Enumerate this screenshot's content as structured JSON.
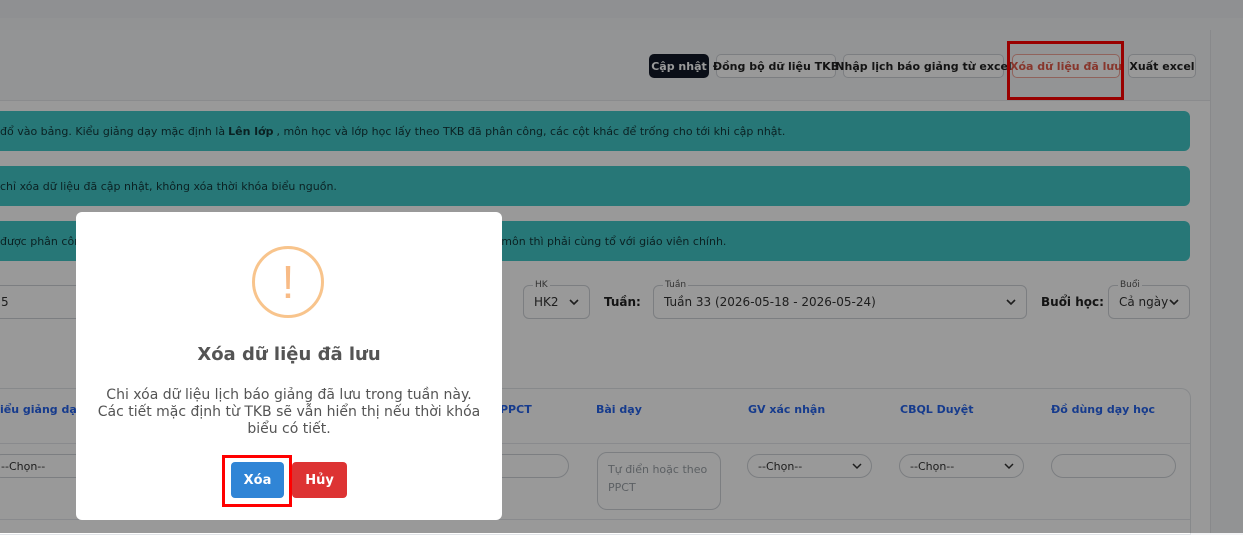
{
  "toolbar": {
    "update": "Cập nhật",
    "sync_tkb": "Đồng bộ dữ liệu TKB",
    "import_excel": "Nhập lịch báo giảng từ excel",
    "delete_saved": "Xóa dữ liệu đã lưu",
    "export_excel": "Xuất excel"
  },
  "alerts": {
    "a1_pre": "đổ vào bảng. Kiểu giảng dạy mặc định là",
    "a1_bold": "Lên lớp",
    "a1_post": ", môn học và lớp học lấy theo TKB đã phân công, các cột khác để trống cho tới khi cập nhật.",
    "a2": "chỉ xóa dữ liệu đã cập nhật, không xóa thời khóa biểu nguồn.",
    "a3_left": "được phân côn",
    "a3_right": "iên môn thì phải cùng tổ với giáo viên chính."
  },
  "filters": {
    "year_fragment": "5",
    "hk_label": "HK",
    "hk_value": "HK2",
    "tuan_text": "Tuần:",
    "tuan_label": "Tuần",
    "tuan_value": "Tuần 33 (2026-05-18 - 2026-05-24)",
    "buoi_text": "Buổi học:",
    "buoi_label": "Buổi",
    "buoi_value": "Cả ngày"
  },
  "table": {
    "headers": [
      "iểu giảng dạy",
      "PPCT",
      "Bài dạy",
      "GV xác nhận",
      "CBQL Duyệt",
      "Đồ dùng dạy học"
    ],
    "row1": {
      "type_select": "--Chọn--",
      "lesson_placeholder": "Tự điển hoặc theo PPCT",
      "gv_select": "--Chọn--",
      "cbql_select": "--Chọn--"
    }
  },
  "modal": {
    "icon": "warning-icon",
    "icon_glyph": "!",
    "title": "Xóa dữ liệu đã lưu",
    "text": "Chi xóa dữ liệu lịch báo giảng đã lưu trong tuần này. Các tiết mặc định từ TKB sẽ vẫn hiển thị nếu thời khóa biểu có tiết.",
    "confirm": "Xóa",
    "cancel": "Hủy"
  },
  "colors": {
    "alert_bg": "#42c6c6",
    "confirm": "#3085d6",
    "cancel": "#dd3333",
    "highlight": "#ff0000"
  }
}
